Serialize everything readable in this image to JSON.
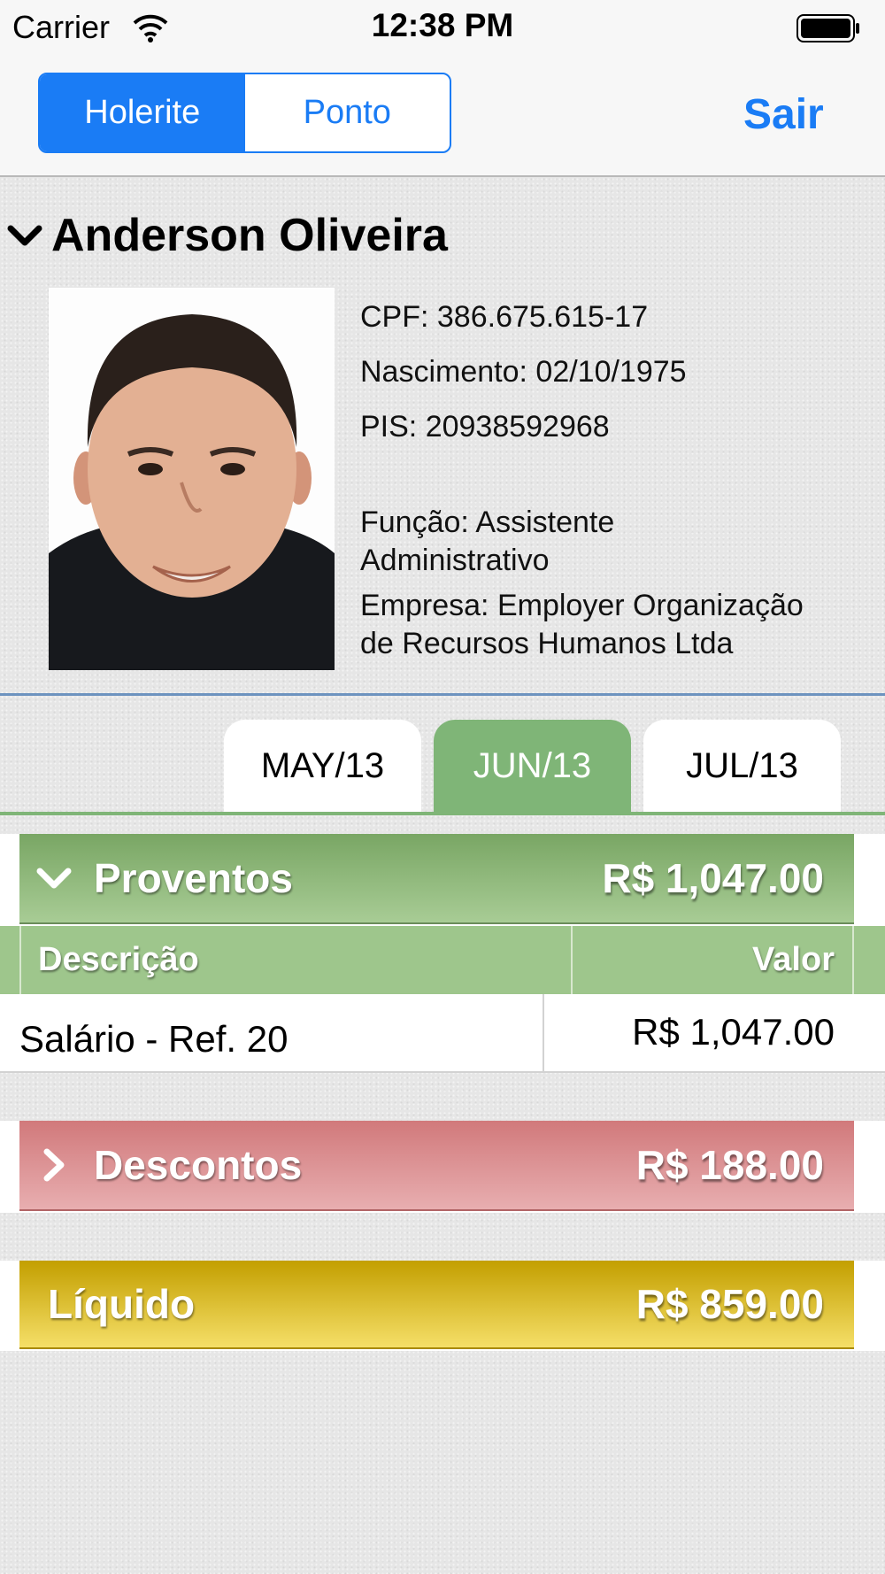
{
  "status_bar": {
    "carrier": "Carrier",
    "time": "12:38 PM",
    "wifi_icon": "wifi-icon",
    "battery_icon": "battery-icon"
  },
  "nav": {
    "segments": [
      {
        "label": "Holerite",
        "selected": true
      },
      {
        "label": "Ponto",
        "selected": false
      }
    ],
    "logout": "Sair"
  },
  "employee": {
    "name": "Anderson Oliveira",
    "cpf": "CPF: 386.675.615-17",
    "birth": "Nascimento: 02/10/1975",
    "pis": "PIS: 20938592968",
    "role_line1": "Função: Assistente",
    "role_line2": "Administrativo",
    "company_line1": "Empresa: Employer Organização",
    "company_line2": "de Recursos Humanos Ltda"
  },
  "months": [
    {
      "label": "MAY/13",
      "selected": false
    },
    {
      "label": "JUN/13",
      "selected": true
    },
    {
      "label": "JUL/13",
      "selected": false
    }
  ],
  "proventos": {
    "title": "Proventos",
    "total": "R$ 1,047.00",
    "columns": {
      "description": "Descrição",
      "value": "Valor"
    },
    "rows": [
      {
        "description": "Salário - Ref. 20",
        "value": "R$ 1,047.00"
      }
    ]
  },
  "descontos": {
    "title": "Descontos",
    "total": "R$ 188.00"
  },
  "liquido": {
    "title": "Líquido",
    "total": "R$ 859.00"
  },
  "colors": {
    "accent": "#1a7cf5",
    "proventos": "#79a664",
    "descontos": "#d1797b",
    "liquido": "#c39f00"
  }
}
